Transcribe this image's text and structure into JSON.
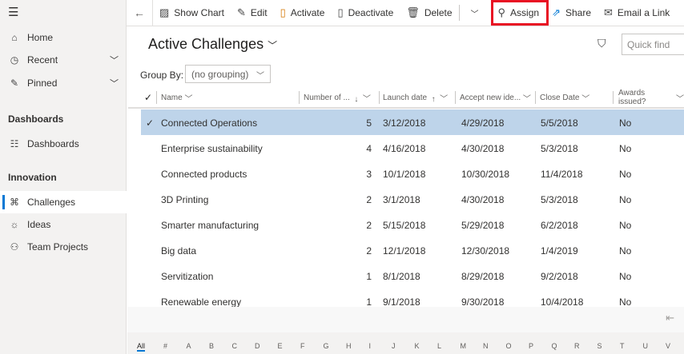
{
  "sidebar": {
    "menu_icon": "hamburger-icon",
    "items": [
      {
        "label": "Home",
        "icon": "home-icon"
      },
      {
        "label": "Recent",
        "icon": "clock-icon"
      },
      {
        "label": "Pinned",
        "icon": "pin-icon"
      }
    ],
    "sections": [
      {
        "title": "Dashboards",
        "items": [
          {
            "label": "Dashboards",
            "icon": "dashboard-icon"
          }
        ]
      },
      {
        "title": "Innovation",
        "items": [
          {
            "label": "Challenges",
            "icon": "binoculars-icon",
            "active": true
          },
          {
            "label": "Ideas",
            "icon": "lightbulb-icon"
          },
          {
            "label": "Team Projects",
            "icon": "team-icon"
          }
        ]
      }
    ]
  },
  "toolbar": {
    "show_chart": "Show Chart",
    "edit": "Edit",
    "activate": "Activate",
    "deactivate": "Deactivate",
    "delete": "Delete",
    "assign": "Assign",
    "share": "Share",
    "email_link": "Email a Link",
    "highlight_color": "#e81123"
  },
  "view": {
    "title": "Active Challenges",
    "quick_find_placeholder": "Quick find",
    "group_by_label": "Group By:",
    "group_by_value": "(no grouping)"
  },
  "grid": {
    "columns": [
      "Name",
      "Number of ...",
      "Launch date",
      "Accept new ide...",
      "Close Date",
      "Awards issued?"
    ],
    "rows": [
      [
        "Connected Operations",
        "5",
        "3/12/2018",
        "4/29/2018",
        "5/5/2018",
        "No"
      ],
      [
        "Enterprise sustainability",
        "4",
        "4/16/2018",
        "4/30/2018",
        "5/3/2018",
        "No"
      ],
      [
        "Connected products",
        "3",
        "10/1/2018",
        "10/30/2018",
        "11/4/2018",
        "No"
      ],
      [
        "3D Printing",
        "2",
        "3/1/2018",
        "4/30/2018",
        "5/3/2018",
        "No"
      ],
      [
        "Smarter manufacturing",
        "2",
        "5/15/2018",
        "5/29/2018",
        "6/2/2018",
        "No"
      ],
      [
        "Big data",
        "2",
        "12/1/2018",
        "12/30/2018",
        "1/4/2019",
        "No"
      ],
      [
        "Servitization",
        "1",
        "8/1/2018",
        "8/29/2018",
        "9/2/2018",
        "No"
      ],
      [
        "Renewable energy",
        "1",
        "9/1/2018",
        "9/30/2018",
        "10/4/2018",
        "No"
      ]
    ]
  },
  "alphabet": [
    "All",
    "#",
    "A",
    "B",
    "C",
    "D",
    "E",
    "F",
    "G",
    "H",
    "I",
    "J",
    "K",
    "L",
    "M",
    "N",
    "O",
    "P",
    "Q",
    "R",
    "S",
    "T",
    "U",
    "V"
  ]
}
